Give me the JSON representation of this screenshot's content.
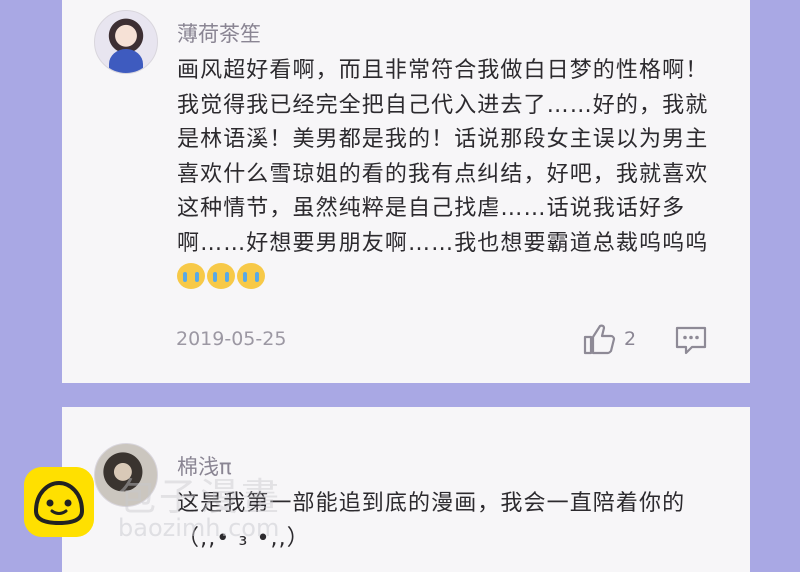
{
  "comments": [
    {
      "username": "薄荷茶笙",
      "text": "画风超好看啊，而且非常符合我做白日梦的性格啊！我觉得我已经完全把自己代入进去了……好的，我就是林语溪！美男都是我的！话说那段女主误以为男主喜欢什么雪琼姐的看的我有点纠结，好吧，我就喜欢这种情节，虽然纯粹是自己找虐……话说我话好多啊……好想要男朋友啊……我也想要霸道总裁呜呜呜",
      "emoji_icon": "crying-face-icon",
      "date": "2019-05-25",
      "likes": "2"
    },
    {
      "username": "棉浅π",
      "text": "这是我第一部能追到底的漫画，我会一直陪着你的 （,,•  ₃  •,,）"
    }
  ],
  "watermark": {
    "chinese": "包子漫畫",
    "url": "baozimh.com"
  },
  "colors": {
    "background": "#a9a8e4",
    "card": "#f7f6f8",
    "logo": "#ffe000"
  }
}
